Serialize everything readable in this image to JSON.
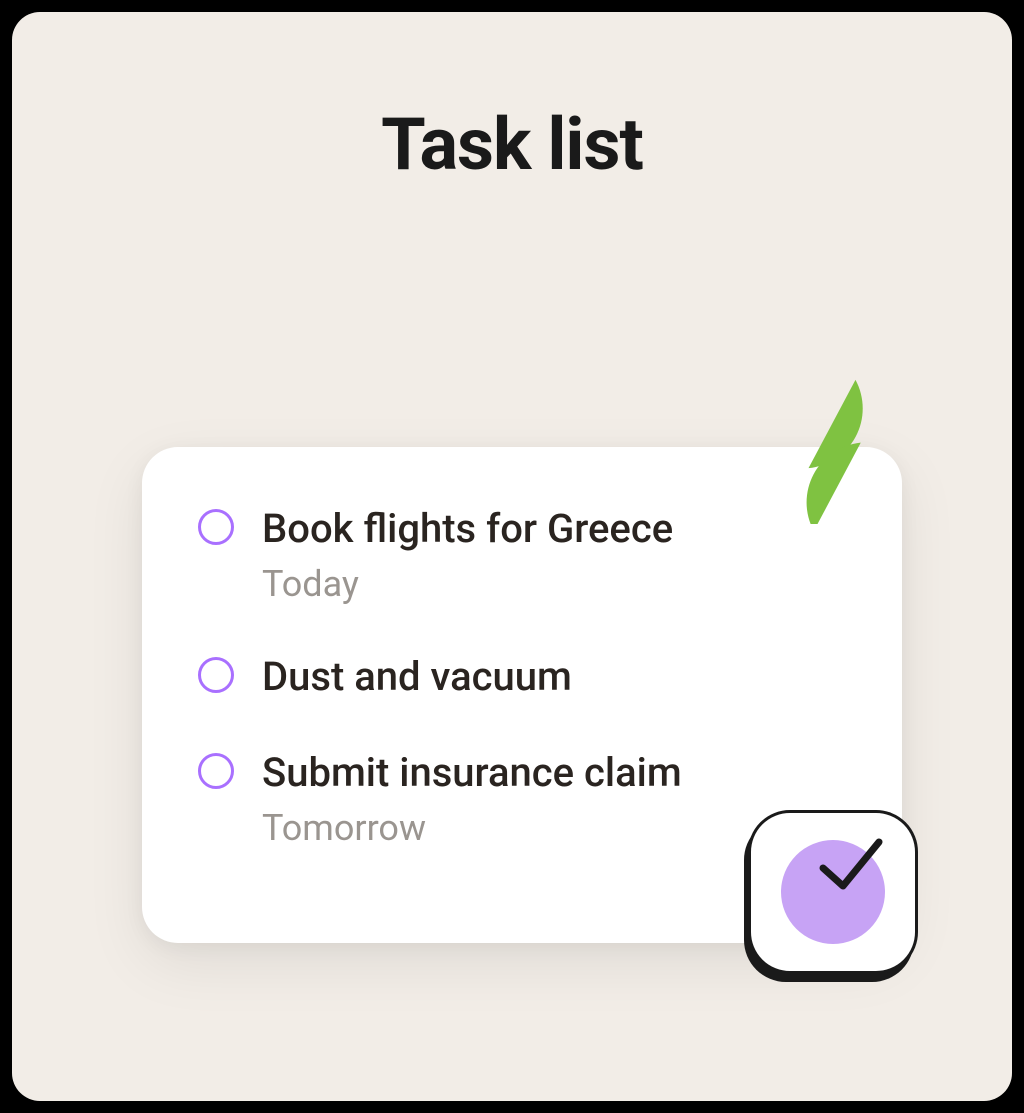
{
  "header": {
    "title": "Task list"
  },
  "tasks": [
    {
      "title": "Book flights for Greece",
      "due": "Today"
    },
    {
      "title": "Dust and vacuum",
      "due": ""
    },
    {
      "title": "Submit insurance claim",
      "due": "Tomorrow"
    }
  ],
  "colors": {
    "accent": "#a970ff",
    "leaf": "#7fc241",
    "badgeCircle": "#c7a3f5"
  }
}
